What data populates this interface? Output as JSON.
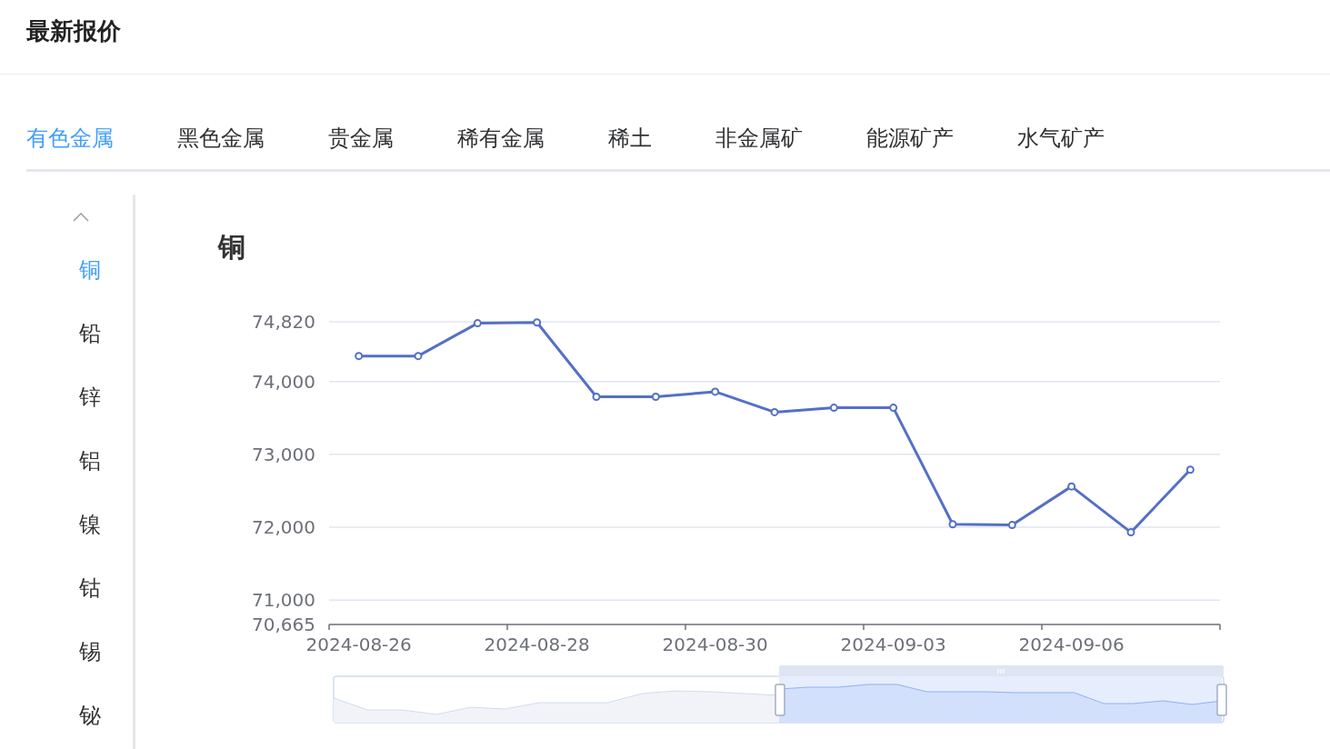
{
  "header": {
    "title": "最新报价"
  },
  "tabs": [
    {
      "label": "有色金属",
      "selected": true
    },
    {
      "label": "黑色金属",
      "selected": false
    },
    {
      "label": "贵金属",
      "selected": false
    },
    {
      "label": "稀有金属",
      "selected": false
    },
    {
      "label": "稀土",
      "selected": false
    },
    {
      "label": "非金属矿",
      "selected": false
    },
    {
      "label": "能源矿产",
      "selected": false
    },
    {
      "label": "水气矿产",
      "selected": false
    }
  ],
  "sidebar": {
    "items": [
      {
        "label": "铜",
        "selected": true
      },
      {
        "label": "铅",
        "selected": false
      },
      {
        "label": "锌",
        "selected": false
      },
      {
        "label": "铝",
        "selected": false
      },
      {
        "label": "镍",
        "selected": false
      },
      {
        "label": "钴",
        "selected": false
      },
      {
        "label": "锡",
        "selected": false
      },
      {
        "label": "铋",
        "selected": false
      }
    ]
  },
  "chart": {
    "chart_data": {
      "type": "line",
      "title": "铜",
      "categories": [
        "2024-08-26",
        null,
        null,
        "2024-08-28",
        null,
        null,
        "2024-08-30",
        null,
        null,
        "2024-09-03",
        null,
        null,
        "2024-09-06",
        null,
        null
      ],
      "grid": true,
      "ylim": [
        70665,
        74820
      ],
      "yticks": [
        {
          "value": 70665,
          "label": "70,665"
        },
        {
          "value": 71000,
          "label": "71,000"
        },
        {
          "value": 72000,
          "label": "72,000"
        },
        {
          "value": 73000,
          "label": "73,000"
        },
        {
          "value": 74000,
          "label": "74,000"
        },
        {
          "value": 74820,
          "label": "74,820"
        }
      ],
      "series": [
        {
          "color": "#5470c6",
          "marker": true,
          "values": [
            74350,
            74350,
            74800,
            74810,
            73790,
            73790,
            73860,
            73580,
            73640,
            73640,
            72040,
            72030,
            72560,
            71930,
            72790
          ]
        }
      ]
    }
  }
}
